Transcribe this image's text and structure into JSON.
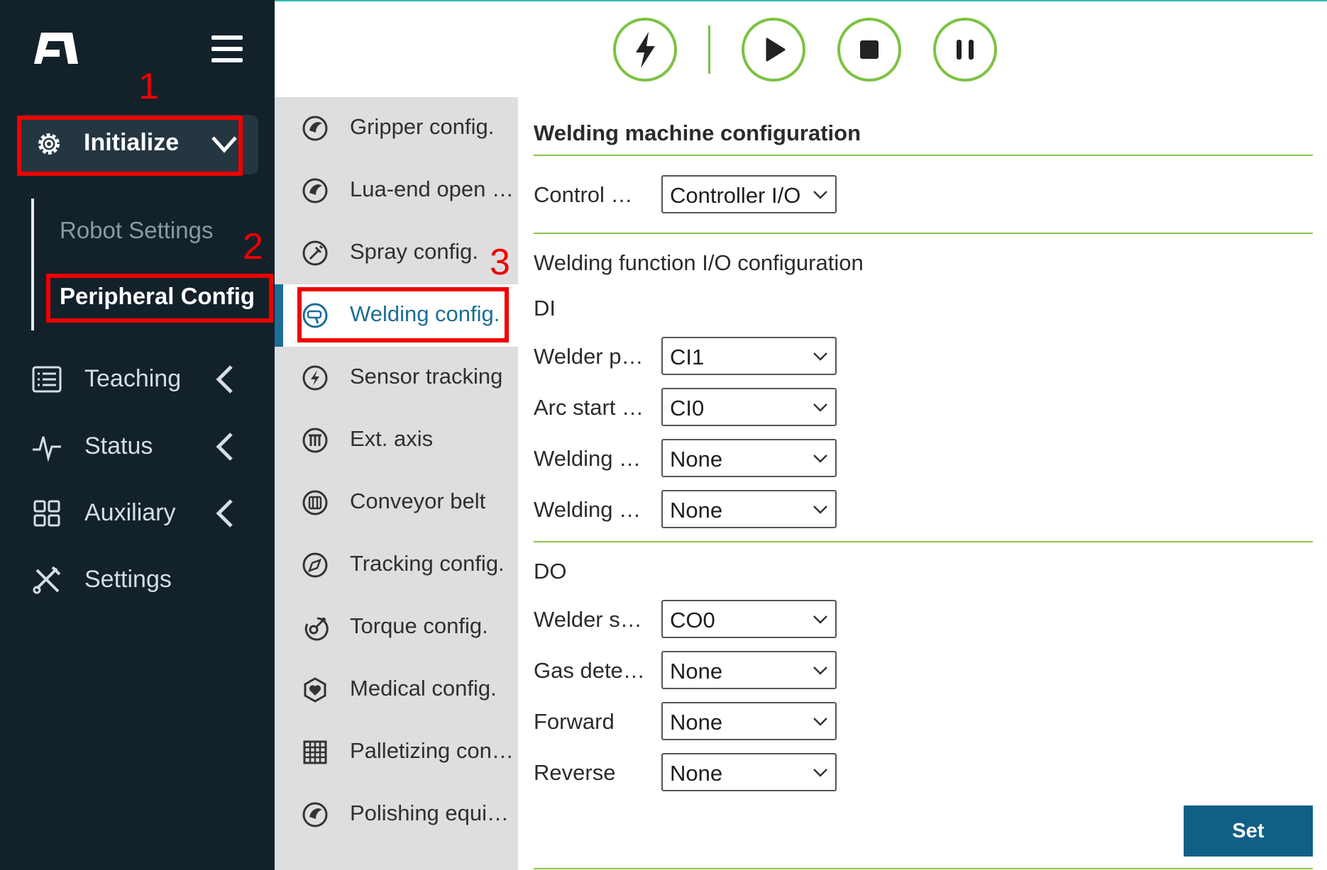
{
  "sidebar": {
    "logo_icon": "brand-logo",
    "menu_icon": "hamburger-icon",
    "initialize": {
      "label": "Initialize",
      "icon": "gear-icon",
      "expanded": true
    },
    "sub_items": [
      {
        "label": "Robot Settings",
        "active": false
      },
      {
        "label": "Peripheral Config",
        "active": true
      }
    ],
    "nav": [
      {
        "label": "Teaching",
        "icon": "list-icon"
      },
      {
        "label": "Status",
        "icon": "pulse-icon"
      },
      {
        "label": "Auxiliary",
        "icon": "grid-icon"
      },
      {
        "label": "Settings",
        "icon": "tools-icon"
      }
    ]
  },
  "toolbar": {
    "buttons": [
      {
        "name": "enable",
        "icon": "lightning-icon"
      },
      {
        "name": "run",
        "icon": "play-icon"
      },
      {
        "name": "stop",
        "icon": "stop-icon"
      },
      {
        "name": "pause",
        "icon": "pause-icon"
      }
    ],
    "accent_color": "#7cc242"
  },
  "peripheral_menu": {
    "items": [
      {
        "label": "Gripper config.",
        "icon": "gripper-icon"
      },
      {
        "label": "Lua-end open protocol",
        "icon": "lua-end-icon"
      },
      {
        "label": "Spray config.",
        "icon": "spray-icon"
      },
      {
        "label": "Welding config.",
        "icon": "welding-torch-icon",
        "active": true
      },
      {
        "label": "Sensor tracking",
        "icon": "sensor-icon"
      },
      {
        "label": "Ext. axis",
        "icon": "ext-axis-icon"
      },
      {
        "label": "Conveyor belt",
        "icon": "conveyor-icon"
      },
      {
        "label": "Tracking config.",
        "icon": "tracking-icon"
      },
      {
        "label": "Torque config.",
        "icon": "torque-icon"
      },
      {
        "label": "Medical config.",
        "icon": "medical-icon"
      },
      {
        "label": "Palletizing config.",
        "icon": "palletizing-icon"
      },
      {
        "label": "Polishing equipment",
        "icon": "polishing-icon"
      }
    ],
    "active_color": "#1b6d96"
  },
  "form": {
    "title": "Welding machine configuration",
    "control_mode": {
      "label": "Control mode",
      "value": "Controller I/O"
    },
    "io_heading": "Welding function I/O configuration",
    "di_heading": "DI",
    "di_rows": [
      {
        "label": "Welder power",
        "value": "CI1"
      },
      {
        "label": "Arc start success",
        "value": "CI0"
      },
      {
        "label": "Welding ready",
        "value": "None"
      },
      {
        "label": "Welding wire",
        "value": "None"
      }
    ],
    "do_heading": "DO",
    "do_rows": [
      {
        "label": "Welder start",
        "value": "CO0"
      },
      {
        "label": "Gas detection",
        "value": "None"
      },
      {
        "label": "Forward",
        "value": "None"
      },
      {
        "label": "Reverse",
        "value": "None"
      }
    ],
    "set_label": "Set",
    "divider_color": "#8bc34a"
  },
  "annotations": {
    "marker_color": "#ee0000",
    "labels": [
      "1",
      "2",
      "3"
    ]
  }
}
